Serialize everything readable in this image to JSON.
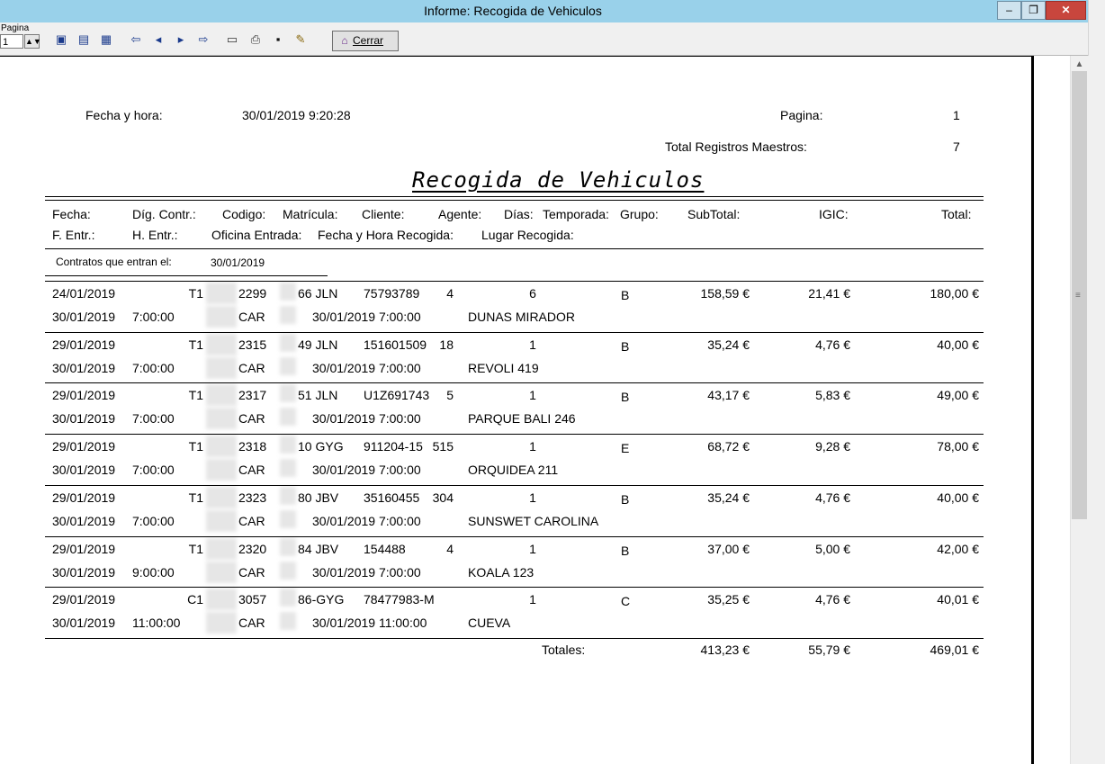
{
  "window": {
    "title": "Informe: Recogida de Vehiculos",
    "minimize_glyph": "‒",
    "restore_glyph": "❐",
    "close_glyph": "✕"
  },
  "toolbar": {
    "page_label": "Pagina",
    "page_value": "1",
    "close_label": "Cerrar",
    "icons": [
      "view-single-icon",
      "view-double-icon",
      "view-list-icon",
      "first-page-icon",
      "prev-page-icon",
      "next-page-icon",
      "last-page-icon",
      "print-setup-icon",
      "print-icon",
      "save-icon",
      "open-icon",
      "door-icon"
    ]
  },
  "header": {
    "date_label": "Fecha y hora:",
    "date_value": "30/01/2019 9:20:28",
    "page_label": "Pagina:",
    "page_value": "1",
    "total_label": "Total Registros Maestros:",
    "total_value": "7",
    "report_title": "Recogida de Vehiculos"
  },
  "columns": {
    "row1": [
      "Fecha:",
      "Díg. Contr.:",
      "Codigo:",
      "Matrícula:",
      "Cliente:",
      "Agente:",
      "Días:",
      "Temporada:",
      "Grupo:",
      "SubTotal:",
      "IGIC:",
      "Total:"
    ],
    "row2": [
      "F. Entr.:",
      "H. Entr.:",
      "Oficina Entrada:",
      "Fecha y Hora Recogida:",
      "Lugar Recogida:"
    ]
  },
  "group": {
    "label": "Contratos que entran el:",
    "date": "30/01/2019"
  },
  "rows": [
    {
      "fecha": "24/01/2019",
      "dig": "T1",
      "codigo": "2299",
      "matricula": "66 JLN",
      "cliente": "75793789",
      "agente": "4",
      "dias": "6",
      "grupo": "B",
      "subtotal": "158,59 €",
      "igic": "21,41 €",
      "total": "180,00 €",
      "f_entr": "30/01/2019",
      "h_entr": "7:00:00",
      "oficina": "CAR",
      "fh_recogida": "30/01/2019  7:00:00",
      "lugar": "DUNAS MIRADOR"
    },
    {
      "fecha": "29/01/2019",
      "dig": "T1",
      "codigo": "2315",
      "matricula": "49 JLN",
      "cliente": "151601509",
      "agente": "18",
      "dias": "1",
      "grupo": "B",
      "subtotal": "35,24 €",
      "igic": "4,76 €",
      "total": "40,00 €",
      "f_entr": "30/01/2019",
      "h_entr": "7:00:00",
      "oficina": "CAR",
      "fh_recogida": "30/01/2019  7:00:00",
      "lugar": "REVOLI 419"
    },
    {
      "fecha": "29/01/2019",
      "dig": "T1",
      "codigo": "2317",
      "matricula": "51 JLN",
      "cliente": "U1Z691743",
      "agente": "5",
      "dias": "1",
      "grupo": "B",
      "subtotal": "43,17 €",
      "igic": "5,83 €",
      "total": "49,00 €",
      "f_entr": "30/01/2019",
      "h_entr": "7:00:00",
      "oficina": "CAR",
      "fh_recogida": "30/01/2019  7:00:00",
      "lugar": "PARQUE BALI 246"
    },
    {
      "fecha": "29/01/2019",
      "dig": "T1",
      "codigo": "2318",
      "matricula": "10 GYG",
      "cliente": "911204-15",
      "agente": "515",
      "dias": "1",
      "grupo": "E",
      "subtotal": "68,72 €",
      "igic": "9,28 €",
      "total": "78,00 €",
      "f_entr": "30/01/2019",
      "h_entr": "7:00:00",
      "oficina": "CAR",
      "fh_recogida": "30/01/2019  7:00:00",
      "lugar": "ORQUIDEA 211"
    },
    {
      "fecha": "29/01/2019",
      "dig": "T1",
      "codigo": "2323",
      "matricula": "80 JBV",
      "cliente": "35160455",
      "agente": "304",
      "dias": "1",
      "grupo": "B",
      "subtotal": "35,24 €",
      "igic": "4,76 €",
      "total": "40,00 €",
      "f_entr": "30/01/2019",
      "h_entr": "7:00:00",
      "oficina": "CAR",
      "fh_recogida": "30/01/2019  7:00:00",
      "lugar": "SUNSWET CAROLINA"
    },
    {
      "fecha": "29/01/2019",
      "dig": "T1",
      "codigo": "2320",
      "matricula": "84 JBV",
      "cliente": "154488",
      "agente": "4",
      "dias": "1",
      "grupo": "B",
      "subtotal": "37,00 €",
      "igic": "5,00 €",
      "total": "42,00 €",
      "f_entr": "30/01/2019",
      "h_entr": "9:00:00",
      "oficina": "CAR",
      "fh_recogida": "30/01/2019  7:00:00",
      "lugar": "KOALA 123"
    },
    {
      "fecha": "29/01/2019",
      "dig": "C1",
      "codigo": "3057",
      "matricula": "86-GYG",
      "cliente": "78477983-M",
      "agente": "",
      "dias": "1",
      "grupo": "C",
      "subtotal": "35,25 €",
      "igic": "4,76 €",
      "total": "40,01 €",
      "f_entr": "30/01/2019",
      "h_entr": "11:00:00",
      "oficina": "CAR",
      "fh_recogida": "30/01/2019  11:00:00",
      "lugar": "CUEVA"
    }
  ],
  "totals": {
    "label": "Totales:",
    "subtotal": "413,23 €",
    "igic": "55,79 €",
    "total": "469,01 €"
  }
}
